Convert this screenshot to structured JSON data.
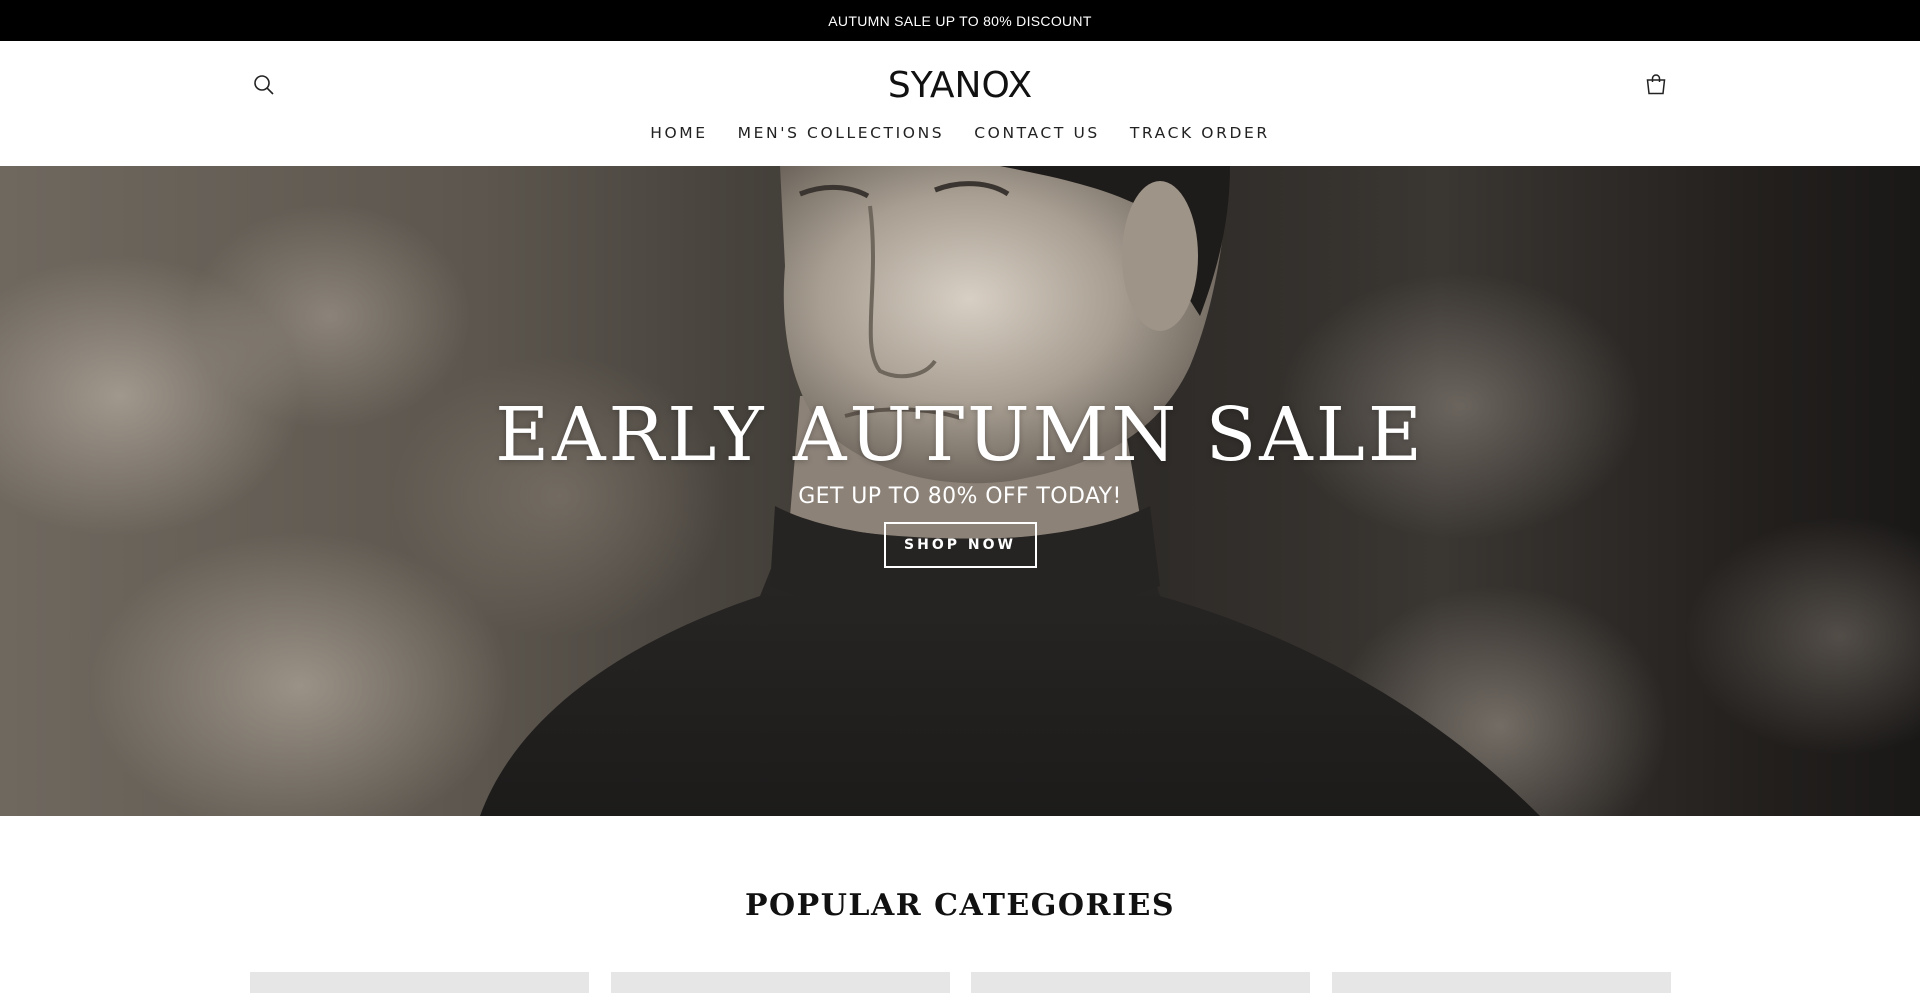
{
  "announcement": {
    "text": "AUTUMN SALE UP TO 80% DISCOUNT"
  },
  "header": {
    "logo": "SYANOX",
    "search_icon": "search-icon",
    "cart_icon": "shopping-bag-icon"
  },
  "nav": {
    "items": [
      {
        "label": "HOME"
      },
      {
        "label": "MEN'S COLLECTIONS"
      },
      {
        "label": "CONTACT US"
      },
      {
        "label": "TRACK ORDER"
      }
    ]
  },
  "hero": {
    "title": "EARLY AUTUMN SALE",
    "subtitle": "GET UP TO 80% OFF TODAY!",
    "button_label": "SHOP NOW"
  },
  "categories": {
    "title": "POPULAR CATEGORIES"
  },
  "colors": {
    "announcement_bg": "#000000",
    "text": "#111111",
    "hero_text": "#ffffff",
    "card_placeholder": "#e6e6e6"
  }
}
